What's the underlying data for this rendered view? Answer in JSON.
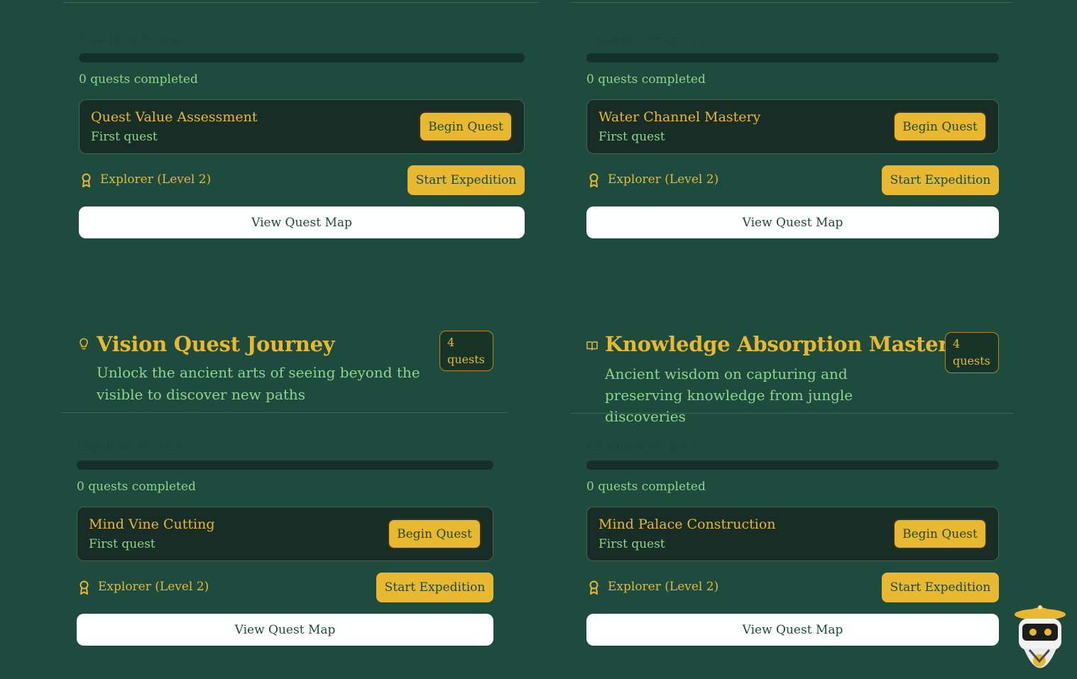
{
  "progress_label": "Expedition Progress",
  "colors": {
    "background": "#1f4a3e",
    "accent": "#e8b830",
    "text_green": "#8fd48f",
    "panel": "#172d26"
  },
  "cards": [
    {
      "progress": {
        "fraction": 0,
        "count_text": "0 quests completed"
      },
      "quest": {
        "title": "Quest Value Assessment",
        "subtitle": "First quest",
        "button": "Begin Quest"
      },
      "rank": "Explorer (Level 2)",
      "start_button": "Start Expedition",
      "map_button": "View Quest Map"
    },
    {
      "progress": {
        "fraction": 0,
        "count_text": "0 quests completed"
      },
      "quest": {
        "title": "Water Channel Mastery",
        "subtitle": "First quest",
        "button": "Begin Quest"
      },
      "rank": "Explorer (Level 2)",
      "start_button": "Start Expedition",
      "map_button": "View Quest Map"
    },
    {
      "header": {
        "icon": "lightbulb-icon",
        "title": "Vision Quest Journey",
        "description": "Unlock the ancient arts of seeing beyond the visible to discover new paths",
        "badge_count": "4",
        "badge_unit": "quests"
      },
      "progress": {
        "fraction": 0,
        "count_text": "0 quests completed"
      },
      "quest": {
        "title": "Mind Vine Cutting",
        "subtitle": "First quest",
        "button": "Begin Quest"
      },
      "rank": "Explorer (Level 2)",
      "start_button": "Start Expedition",
      "map_button": "View Quest Map"
    },
    {
      "header": {
        "icon": "open-book-icon",
        "title": "Knowledge Absorption Mastery",
        "description": "Ancient wisdom on capturing and preserving knowledge from jungle discoveries",
        "badge_count": "4",
        "badge_unit": "quests"
      },
      "progress": {
        "fraction": 0,
        "count_text": "0 quests completed"
      },
      "quest": {
        "title": "Mind Palace Construction",
        "subtitle": "First quest",
        "button": "Begin Quest"
      },
      "rank": "Explorer (Level 2)",
      "start_button": "Start Expedition",
      "map_button": "View Quest Map"
    }
  ],
  "mascot": {
    "icon": "explorer-robot-icon"
  }
}
